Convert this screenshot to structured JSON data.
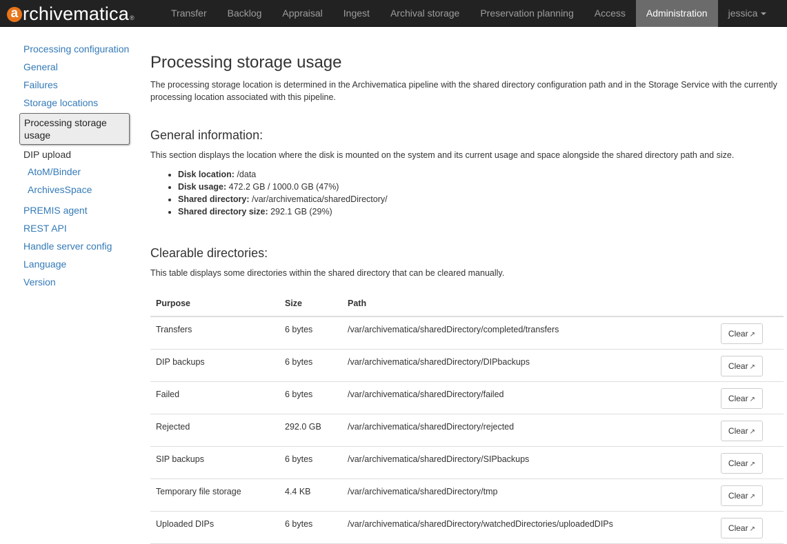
{
  "brand": {
    "prefix": "a",
    "rest": "rchivematica",
    "reg": "®"
  },
  "nav": {
    "items": [
      {
        "label": "Transfer"
      },
      {
        "label": "Backlog"
      },
      {
        "label": "Appraisal"
      },
      {
        "label": "Ingest"
      },
      {
        "label": "Archival storage"
      },
      {
        "label": "Preservation planning"
      },
      {
        "label": "Access"
      },
      {
        "label": "Administration"
      }
    ],
    "user": "jessica"
  },
  "sidebar": {
    "items": [
      {
        "label": "Processing configuration"
      },
      {
        "label": "General"
      },
      {
        "label": "Failures"
      },
      {
        "label": "Storage locations"
      }
    ],
    "active": "Processing storage usage",
    "dip_upload": {
      "label": "DIP upload",
      "children": [
        {
          "label": "AtoM/Binder"
        },
        {
          "label": "ArchivesSpace"
        }
      ]
    },
    "items_after": [
      {
        "label": "PREMIS agent"
      },
      {
        "label": "REST API"
      },
      {
        "label": "Handle server config"
      },
      {
        "label": "Language"
      },
      {
        "label": "Version"
      }
    ]
  },
  "main": {
    "title": "Processing storage usage",
    "intro": "The processing storage location is determined in the Archivematica pipeline with the shared directory configuration path and in the Storage Service with the currently processing location associated with this pipeline.",
    "general": {
      "heading": "General information:",
      "description": "This section displays the location where the disk is mounted on the system and its current usage and space alongside the shared directory path and size.",
      "items": [
        {
          "label": "Disk location:",
          "value": "/data"
        },
        {
          "label": "Disk usage:",
          "value": "472.2 GB / 1000.0 GB (47%)"
        },
        {
          "label": "Shared directory:",
          "value": "/var/archivematica/sharedDirectory/"
        },
        {
          "label": "Shared directory size:",
          "value": "292.1 GB (29%)"
        }
      ]
    },
    "clearable": {
      "heading": "Clearable directories:",
      "description": "This table displays some directories within the shared directory that can be cleared manually.",
      "columns": {
        "purpose": "Purpose",
        "size": "Size",
        "path": "Path"
      },
      "clear_label": "Clear",
      "clear_glyph": "↗",
      "rows": [
        {
          "purpose": "Transfers",
          "size": "6 bytes",
          "path": "/var/archivematica/sharedDirectory/completed/transfers"
        },
        {
          "purpose": "DIP backups",
          "size": "6 bytes",
          "path": "/var/archivematica/sharedDirectory/DIPbackups"
        },
        {
          "purpose": "Failed",
          "size": "6 bytes",
          "path": "/var/archivematica/sharedDirectory/failed"
        },
        {
          "purpose": "Rejected",
          "size": "292.0 GB",
          "path": "/var/archivematica/sharedDirectory/rejected"
        },
        {
          "purpose": "SIP backups",
          "size": "6 bytes",
          "path": "/var/archivematica/sharedDirectory/SIPbackups"
        },
        {
          "purpose": "Temporary file storage",
          "size": "4.4 KB",
          "path": "/var/archivematica/sharedDirectory/tmp"
        },
        {
          "purpose": "Uploaded DIPs",
          "size": "6 bytes",
          "path": "/var/archivematica/sharedDirectory/watchedDirectories/uploadedDIPs"
        }
      ]
    }
  }
}
